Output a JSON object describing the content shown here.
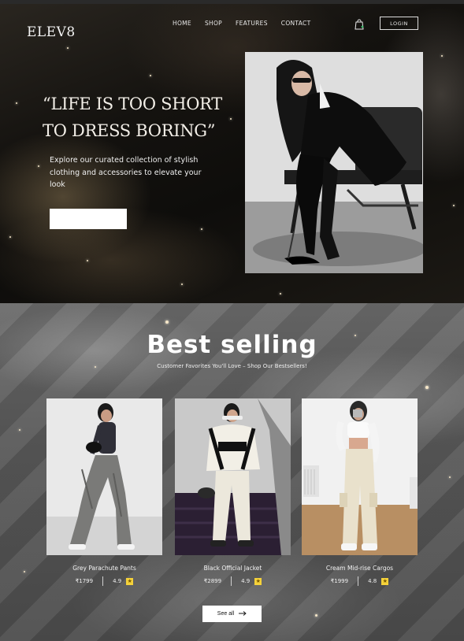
{
  "header": {
    "logo": "ELEV8",
    "nav": [
      "HOME",
      "SHOP",
      "FEATURES",
      "CONTACT"
    ],
    "login_label": "LOGIN"
  },
  "hero": {
    "quote_line1": "“LIFE IS TOO SHORT",
    "quote_line2": "TO DRESS BORING”",
    "description": "Explore our curated collection of stylish clothing and accessories to elevate your look",
    "shop_button_label": ""
  },
  "best_selling": {
    "title": "Best selling",
    "subtitle": "Customer Favorites You'll Love – Shop Our Bestsellers!",
    "products": [
      {
        "name": "Grey Parachute Pants",
        "price": "₹1799",
        "rating": "4.9"
      },
      {
        "name": "Black Official Jacket",
        "price": "₹2899",
        "rating": "4.9"
      },
      {
        "name": "Cream Mid-rise Cargos",
        "price": "₹1999",
        "rating": "4.8"
      }
    ],
    "see_all_label": "See all"
  },
  "colors": {
    "hero_bg": "#121110",
    "section_bg": "#5a5a5a",
    "star": "#f5d23a"
  }
}
